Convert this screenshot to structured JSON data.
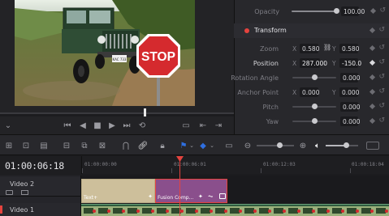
{
  "inspector": {
    "opacity": {
      "label": "Opacity",
      "value": "100.00",
      "level": 1.0
    },
    "transform_title": "Transform",
    "zoom": {
      "label": "Zoom",
      "x_axis": "X",
      "x": "0.580",
      "y_axis": "Y",
      "y": "0.580"
    },
    "position": {
      "label": "Position",
      "x_axis": "X",
      "x": "287.000",
      "y_axis": "Y",
      "y": "-150.0"
    },
    "rotation": {
      "label": "Rotation Angle",
      "value": "0.000"
    },
    "anchor": {
      "label": "Anchor Point",
      "x_axis": "X",
      "x": "0.000",
      "y_axis": "Y",
      "y": "0.000"
    },
    "pitch": {
      "label": "Pitch",
      "value": "0.000"
    },
    "yaw": {
      "label": "Yaw",
      "value": "0.000"
    }
  },
  "viewer": {
    "sign_text": "STOP",
    "plate_text": "KAC 733"
  },
  "timeline": {
    "timecode": "01:00:06:18",
    "ruler": [
      "01:00:00:00",
      "01:00:06:01",
      "01:00:12:03",
      "01:00:18:04"
    ],
    "tracks": [
      {
        "name": "Video 2"
      },
      {
        "name": "Video 1"
      }
    ],
    "clips": {
      "text": "Text+",
      "fusion": "Fusion Comp..."
    }
  },
  "colors": {
    "accent_red": "#e5433e",
    "clip_text": "#cdbf9b",
    "clip_fusion": "#8a4f8c",
    "playhead": "#e5433e",
    "flag_blue": "#2f6fe0"
  }
}
